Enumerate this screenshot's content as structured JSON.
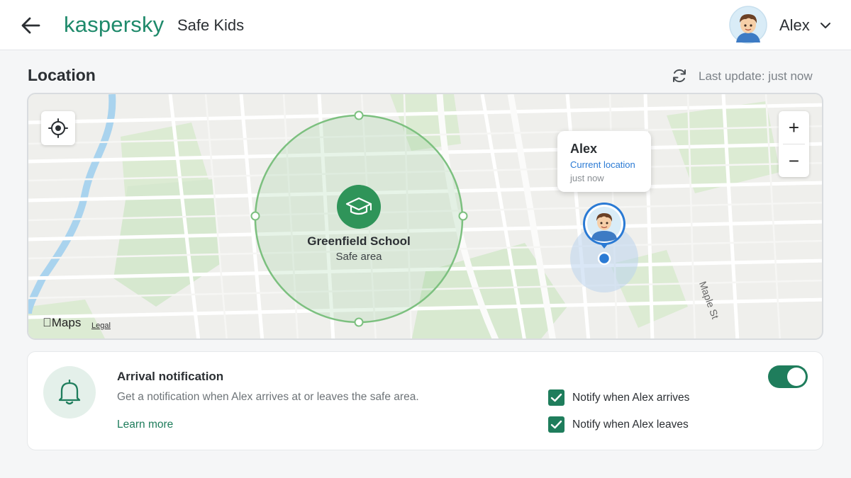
{
  "header": {
    "brand": "kaspersky",
    "product": "Safe Kids",
    "user_name": "Alex",
    "back_icon": "arrow-left-icon",
    "menu_icon": "chevron-down-icon"
  },
  "section": {
    "title": "Location",
    "last_update": "Last update: just now",
    "refresh_icon": "refresh-icon"
  },
  "map": {
    "geofence": {
      "name": "Greenfield School",
      "label": "Safe area",
      "icon": "graduation-cap-icon"
    },
    "child": {
      "name": "Alex",
      "status": "Current location",
      "time": "just now"
    },
    "zoom_in": "+",
    "zoom_out": "−",
    "attribution": "Maps",
    "legal": "Legal",
    "street": "Maple St"
  },
  "notification": {
    "title": "Arrival notification",
    "description": "Get a notification when Alex arrives at or leaves the safe area.",
    "learn_more": "Learn more",
    "enabled": true,
    "options": [
      {
        "label": "Notify when Alex arrives",
        "checked": true
      },
      {
        "label": "Notify when Alex leaves",
        "checked": true
      }
    ]
  },
  "colors": {
    "brand": "#1f8a6b",
    "accent": "#1f7d5c",
    "location_blue": "#2a7ad4",
    "geofence_green": "#7cc07f"
  }
}
